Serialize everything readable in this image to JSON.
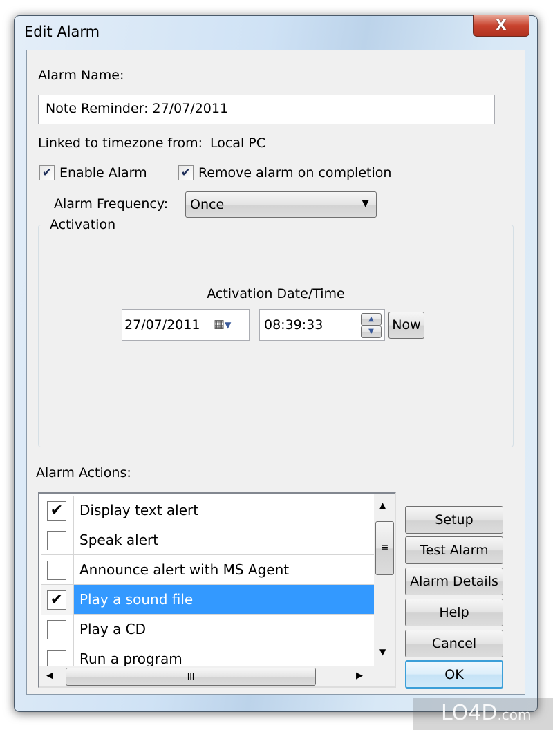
{
  "window": {
    "title": "Edit Alarm",
    "close_label": "X"
  },
  "form": {
    "alarm_name_label": "Alarm Name:",
    "alarm_name_value": "Note Reminder: 27/07/2011",
    "timezone_label": "Linked to timezone from:",
    "timezone_value": "Local PC",
    "enable_alarm": {
      "label": "Enable Alarm",
      "checked": true
    },
    "remove_on_completion": {
      "label": "Remove alarm on completion",
      "checked": true
    },
    "frequency_label": "Alarm Frequency:",
    "frequency_value": "Once"
  },
  "activation": {
    "legend": "Activation",
    "datetime_label": "Activation Date/Time",
    "date": "27/07/2011",
    "time": "08:39:33",
    "now_label": "Now"
  },
  "actions": {
    "label": "Alarm Actions:",
    "items": [
      {
        "label": "Display text alert",
        "checked": true,
        "selected": false
      },
      {
        "label": "Speak alert",
        "checked": false,
        "selected": false
      },
      {
        "label": "Announce alert with MS Agent",
        "checked": false,
        "selected": false
      },
      {
        "label": "Play a sound file",
        "checked": true,
        "selected": true
      },
      {
        "label": "Play a CD",
        "checked": false,
        "selected": false
      },
      {
        "label": "Run a program",
        "checked": false,
        "selected": false
      }
    ]
  },
  "buttons": {
    "setup": "Setup",
    "test": "Test Alarm",
    "details": "Alarm Details",
    "help": "Help",
    "cancel": "Cancel",
    "ok": "OK"
  },
  "watermark": "LO4D.com"
}
